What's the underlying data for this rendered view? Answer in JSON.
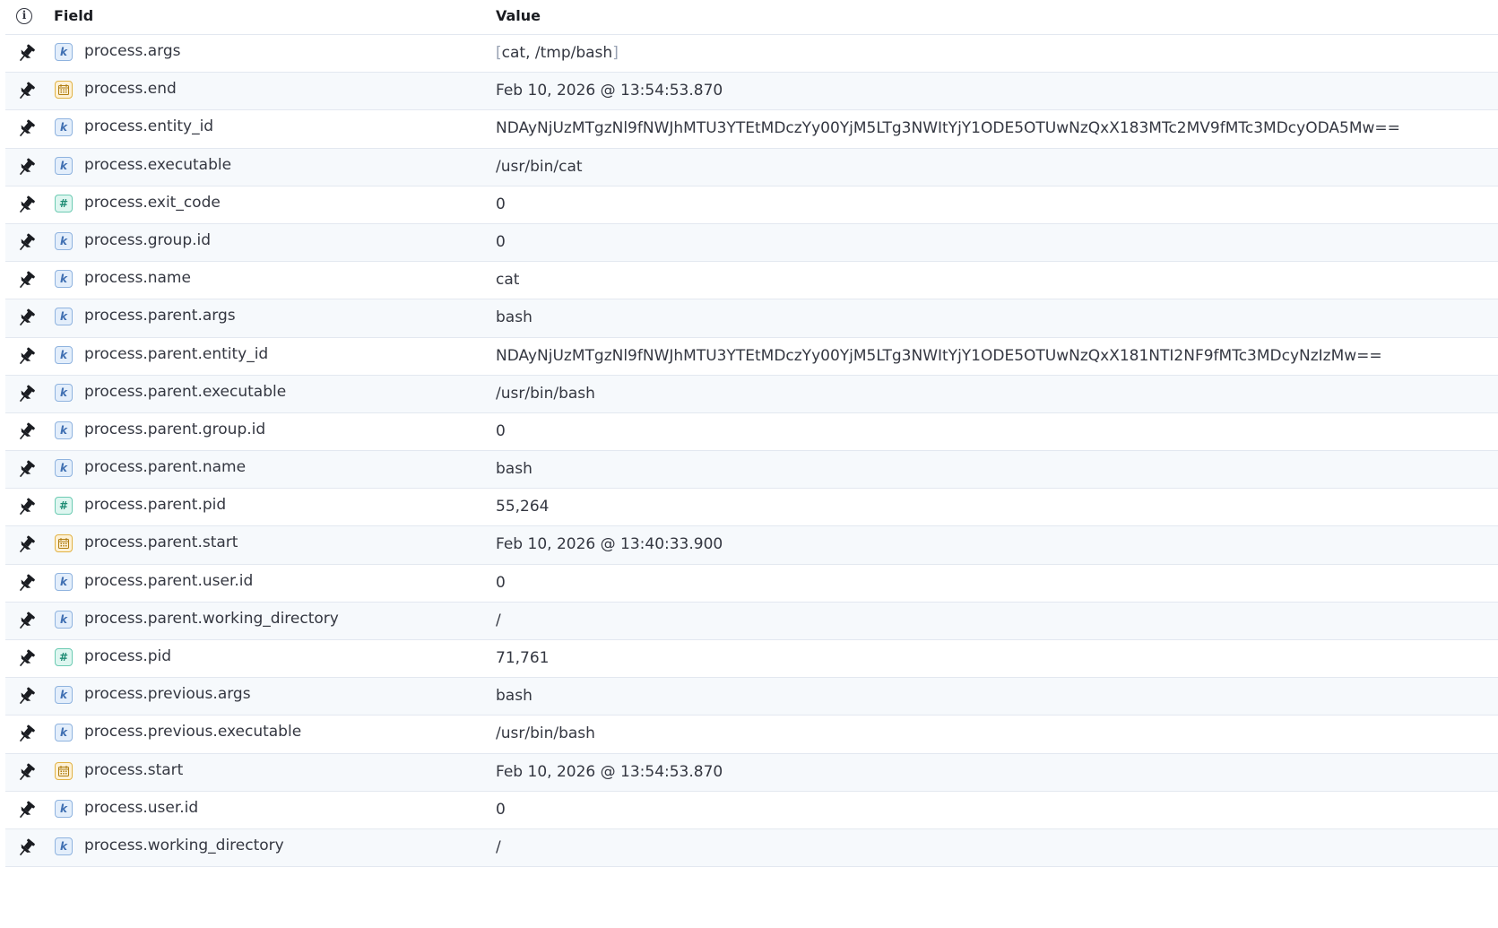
{
  "header": {
    "field_label": "Field",
    "value_label": "Value",
    "info_icon": "i"
  },
  "colors": {
    "keyword": "#3f6fb2",
    "number": "#1e8c74",
    "date": "#e2b345",
    "row_alt": "#f6f9fc"
  },
  "rows": [
    {
      "type": "k",
      "name": "process.args",
      "value": "cat, /tmp/bash",
      "array": true
    },
    {
      "type": "date",
      "name": "process.end",
      "value": "Feb 10, 2026 @ 13:54:53.870"
    },
    {
      "type": "k",
      "name": "process.entity_id",
      "value": "NDAyNjUzMTgzNl9fNWJhMTU3YTEtMDczYy00YjM5LTg3NWItYjY1ODE5OTUwNzQxX183MTc2MV9fMTc3MDcyODA5Mw=="
    },
    {
      "type": "k",
      "name": "process.executable",
      "value": "/usr/bin/cat"
    },
    {
      "type": "num",
      "name": "process.exit_code",
      "value": "0"
    },
    {
      "type": "k",
      "name": "process.group.id",
      "value": "0"
    },
    {
      "type": "k",
      "name": "process.name",
      "value": "cat"
    },
    {
      "type": "k",
      "name": "process.parent.args",
      "value": "bash"
    },
    {
      "type": "k",
      "name": "process.parent.entity_id",
      "value": "NDAyNjUzMTgzNl9fNWJhMTU3YTEtMDczYy00YjM5LTg3NWItYjY1ODE5OTUwNzQxX181NTI2NF9fMTc3MDcyNzIzMw=="
    },
    {
      "type": "k",
      "name": "process.parent.executable",
      "value": "/usr/bin/bash"
    },
    {
      "type": "k",
      "name": "process.parent.group.id",
      "value": "0"
    },
    {
      "type": "k",
      "name": "process.parent.name",
      "value": "bash"
    },
    {
      "type": "num",
      "name": "process.parent.pid",
      "value": "55,264"
    },
    {
      "type": "date",
      "name": "process.parent.start",
      "value": "Feb 10, 2026 @ 13:40:33.900"
    },
    {
      "type": "k",
      "name": "process.parent.user.id",
      "value": "0"
    },
    {
      "type": "k",
      "name": "process.parent.working_directory",
      "value": "/"
    },
    {
      "type": "num",
      "name": "process.pid",
      "value": "71,761"
    },
    {
      "type": "k",
      "name": "process.previous.args",
      "value": "bash"
    },
    {
      "type": "k",
      "name": "process.previous.executable",
      "value": "/usr/bin/bash"
    },
    {
      "type": "date",
      "name": "process.start",
      "value": "Feb 10, 2026 @ 13:54:53.870"
    },
    {
      "type": "k",
      "name": "process.user.id",
      "value": "0"
    },
    {
      "type": "k",
      "name": "process.working_directory",
      "value": "/"
    }
  ]
}
